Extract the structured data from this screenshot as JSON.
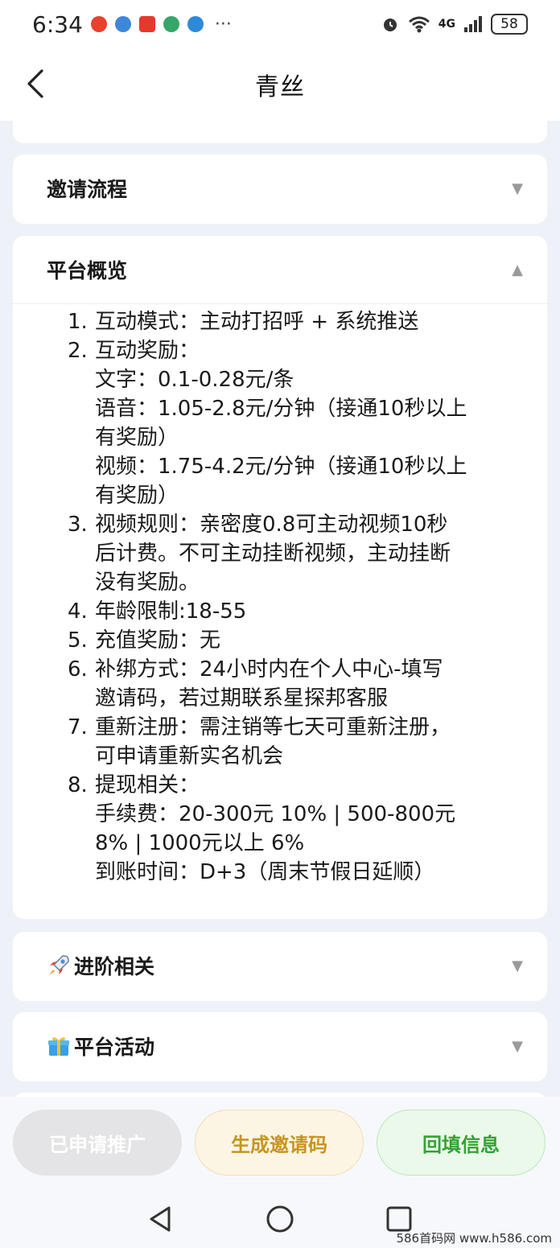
{
  "status_bar": {
    "time": "6:34",
    "dots": "···",
    "network": "4G",
    "battery": "58"
  },
  "header": {
    "title": "青丝"
  },
  "sections": {
    "invite_flow": {
      "title": "邀请流程",
      "arrow": "▼"
    },
    "overview": {
      "title": "平台概览",
      "arrow": "▲"
    },
    "advanced": {
      "title": "进阶相关",
      "arrow": "▼"
    },
    "activity": {
      "title": "平台活动",
      "arrow": "▼"
    }
  },
  "overview_items": [
    {
      "num": "1.",
      "lines": [
        "互动模式：主动打招呼 + 系统推送"
      ]
    },
    {
      "num": "2.",
      "lines": [
        "互动奖励：",
        "文字：0.1-0.28元/条",
        "语音：1.05-2.8元/分钟（接通10秒以上",
        "有奖励）",
        "视频：1.75-4.2元/分钟（接通10秒以上",
        "有奖励）"
      ]
    },
    {
      "num": "3.",
      "lines": [
        "视频规则：亲密度0.8可主动视频10秒",
        "后计费。不可主动挂断视频，主动挂断",
        "没有奖励。"
      ]
    },
    {
      "num": "4.",
      "lines": [
        "年龄限制:18-55"
      ]
    },
    {
      "num": "5.",
      "lines": [
        "充值奖励：无"
      ]
    },
    {
      "num": "6.",
      "lines": [
        "补绑方式：24小时内在个人中心-填写",
        "邀请码，若过期联系星探邦客服"
      ]
    },
    {
      "num": "7.",
      "lines": [
        "重新注册：需注销等七天可重新注册，",
        "可申请重新实名机会"
      ]
    },
    {
      "num": "8.",
      "lines": [
        "提现相关：",
        "手续费：20-300元 10% | 500-800元",
        "8% | 1000元以上 6%",
        "到账时间：D+3（周末节假日延顺）"
      ]
    }
  ],
  "actions": {
    "applied": "已申请推广",
    "generate_code": "生成邀请码",
    "fill_info": "回填信息"
  },
  "watermark": "586首码网 www.h586.com",
  "colors": {
    "background": "#eef1f8",
    "gold": "#c6951f",
    "green": "#33a233"
  }
}
